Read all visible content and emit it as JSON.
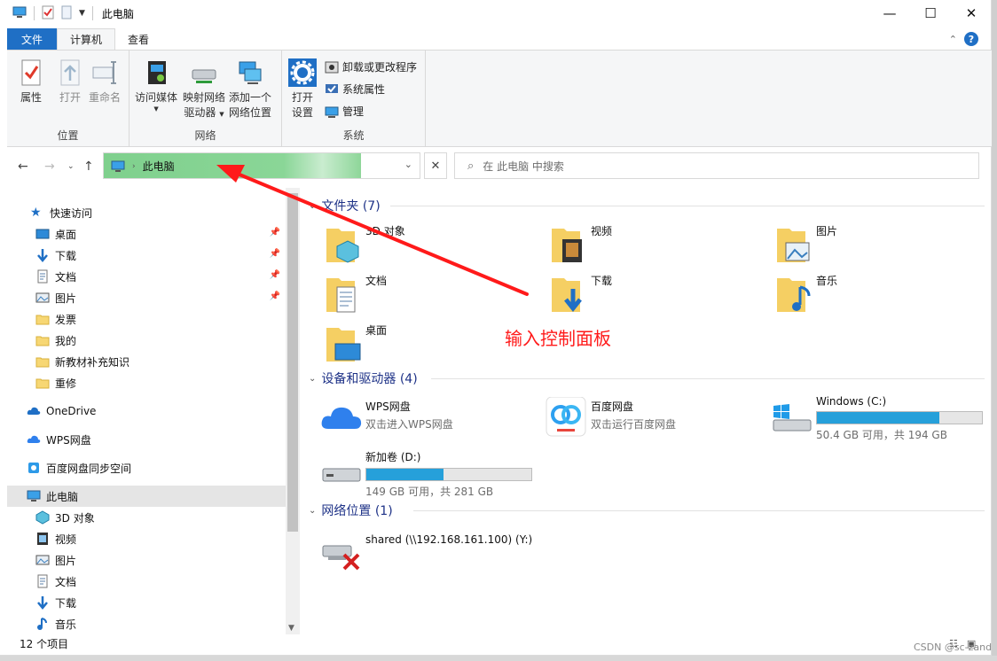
{
  "window": {
    "title": "此电脑",
    "controls": {
      "minimize": "—",
      "maximize": "☐",
      "close": "✕"
    }
  },
  "ribbon": {
    "tabs": [
      {
        "label": "文件"
      },
      {
        "label": "计算机"
      },
      {
        "label": "查看"
      }
    ],
    "groups": {
      "location": {
        "label": "位置",
        "buttons": {
          "properties": "属性",
          "open": "打开",
          "rename": "重命名"
        }
      },
      "network": {
        "label": "网络",
        "buttons": {
          "media_line1": "访问媒体",
          "map_line1": "映射网络",
          "map_line2": "驱动器",
          "add_line1": "添加一个",
          "add_line2": "网络位置"
        }
      },
      "system": {
        "label": "系统",
        "settings_line1": "打开",
        "settings_line2": "设置",
        "uninstall": "卸载或更改程序",
        "sys_props": "系统属性",
        "manage": "管理"
      }
    }
  },
  "address": {
    "path": "此电脑",
    "search_placeholder": "在 此电脑 中搜索"
  },
  "sidebar": {
    "quick_access": "快速访问",
    "quick_items": [
      {
        "label": "桌面",
        "pinned": true
      },
      {
        "label": "下载",
        "pinned": true
      },
      {
        "label": "文档",
        "pinned": true
      },
      {
        "label": "图片",
        "pinned": true
      },
      {
        "label": "发票"
      },
      {
        "label": "我的"
      },
      {
        "label": "新教材补充知识"
      },
      {
        "label": "重修"
      }
    ],
    "onedrive": "OneDrive",
    "wps": "WPS网盘",
    "baidu_sync": "百度网盘同步空间",
    "this_pc": "此电脑",
    "pc_items": [
      {
        "label": "3D 对象"
      },
      {
        "label": "视频"
      },
      {
        "label": "图片"
      },
      {
        "label": "文档"
      },
      {
        "label": "下载"
      },
      {
        "label": "音乐"
      }
    ]
  },
  "content": {
    "folders_header": "文件夹 (7)",
    "folders": [
      {
        "label": "3D 对象"
      },
      {
        "label": "视频"
      },
      {
        "label": "图片"
      },
      {
        "label": "文档"
      },
      {
        "label": "下载"
      },
      {
        "label": "音乐"
      },
      {
        "label": "桌面"
      }
    ],
    "devices_header": "设备和驱动器 (4)",
    "devices": {
      "wps": {
        "name": "WPS网盘",
        "sub": "双击进入WPS网盘"
      },
      "baidu": {
        "name": "百度网盘",
        "sub": "双击运行百度网盘"
      },
      "c": {
        "name": "Windows (C:)",
        "sub": "50.4 GB 可用，共 194 GB",
        "used_fraction": 0.74
      },
      "d": {
        "name": "新加卷 (D:)",
        "sub": "149 GB 可用，共 281 GB",
        "used_fraction": 0.47
      }
    },
    "network_header": "网络位置 (1)",
    "network": {
      "name": "shared (\\\\192.168.161.100) (Y:)"
    }
  },
  "annotation": "输入控制面板",
  "status": {
    "count": "12 个项目"
  },
  "watermark": "CSDN @sc-zand",
  "colors": {
    "accent": "#1f6fc5",
    "bar_fill": "#26a0da",
    "annotation": "#ff1a1a",
    "address_highlight": "#7fd08d",
    "section_header": "#1e3287"
  }
}
